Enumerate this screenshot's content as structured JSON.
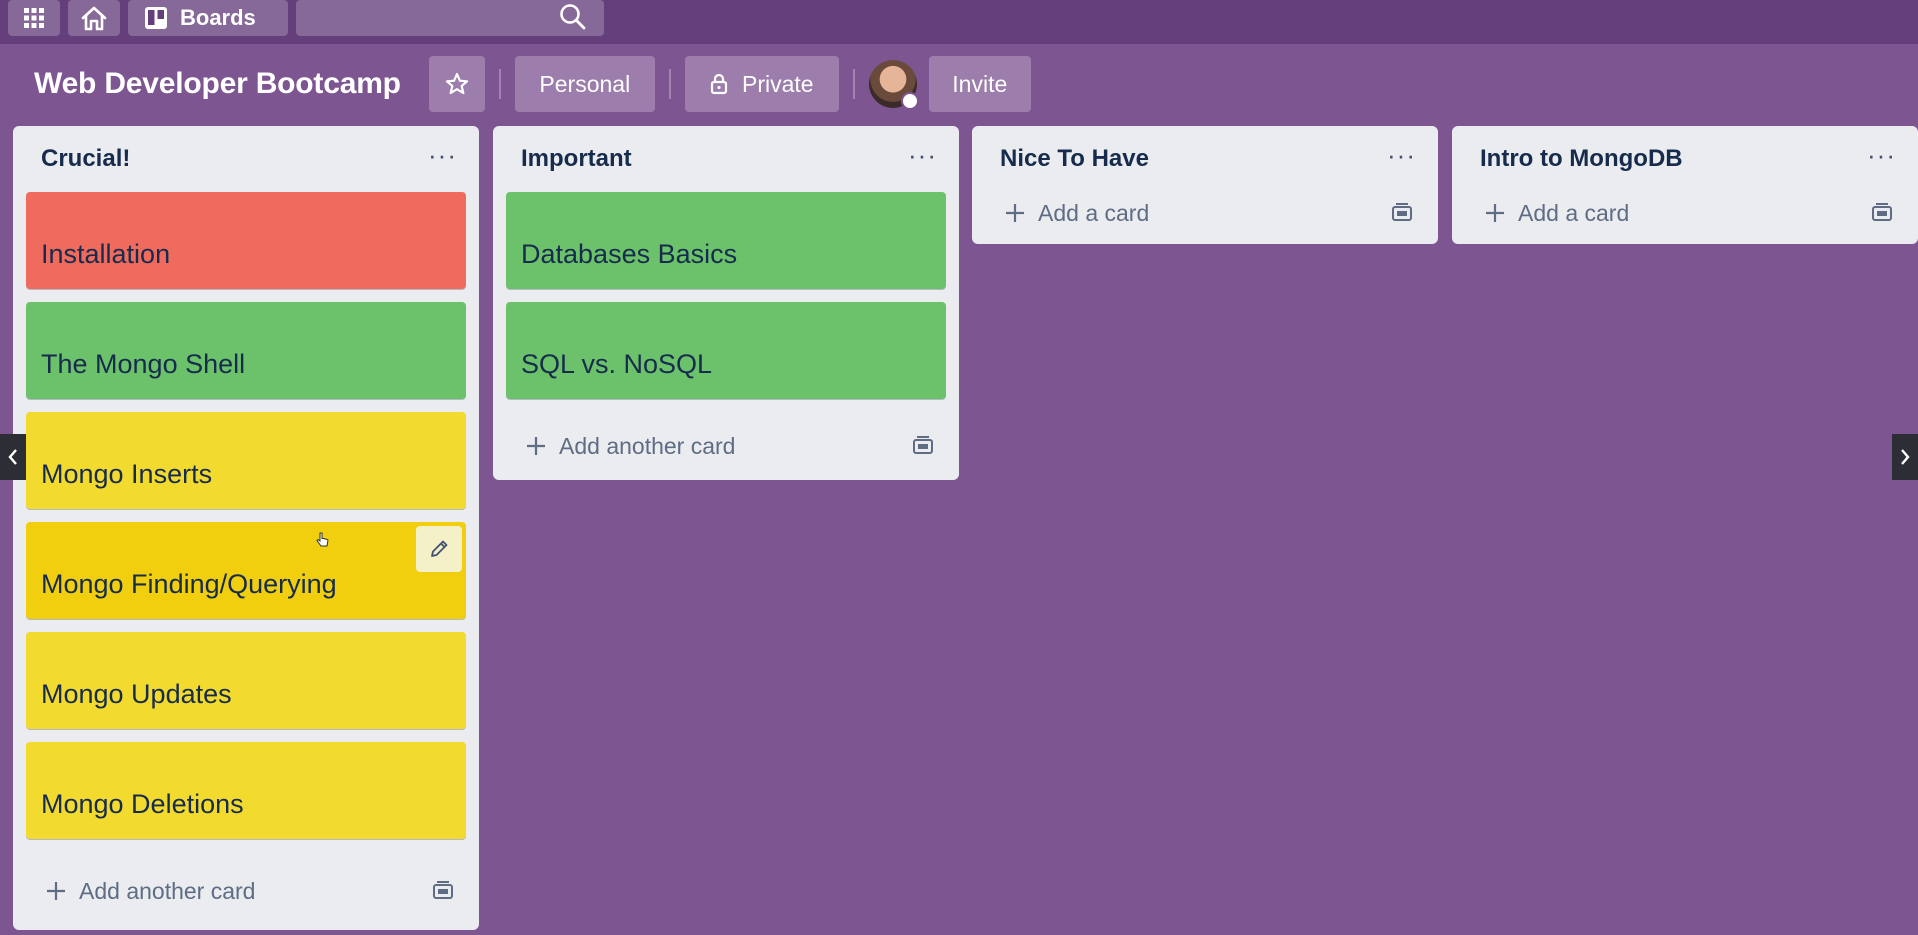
{
  "topbar": {
    "boards_label": "Boards",
    "icons": [
      "apps-grid-icon",
      "home-icon",
      "boards-icon",
      "search-icon"
    ]
  },
  "board": {
    "title": "Web Developer Bootcamp",
    "personal_label": "Personal",
    "private_label": "Private",
    "invite_label": "Invite"
  },
  "lists": [
    {
      "title": "Crucial!",
      "cards": [
        {
          "title": "Installation",
          "color": "#ef6b5e"
        },
        {
          "title": "The Mongo Shell",
          "color": "#6cc26a"
        },
        {
          "title": "Mongo Inserts",
          "color": "#f3da2e"
        },
        {
          "title": "Mongo Finding/Querying",
          "color": "#f1cf0e"
        },
        {
          "title": "Mongo Updates",
          "color": "#f3da2e"
        },
        {
          "title": "Mongo Deletions",
          "color": "#f3da2e"
        }
      ],
      "add_label": "Add another card"
    },
    {
      "title": "Important",
      "cards": [
        {
          "title": "Databases Basics",
          "color": "#6cc26a"
        },
        {
          "title": "SQL vs. NoSQL",
          "color": "#6cc26a"
        }
      ],
      "add_label": "Add another card"
    },
    {
      "title": "Nice To Have",
      "cards": [],
      "add_label": "Add a card"
    },
    {
      "title": "Intro to MongoDB",
      "cards": [],
      "add_label": "Add a card"
    }
  ],
  "colors": {
    "background": "#7d5591",
    "topbar": "#653f7b",
    "list_bg": "#ebecf0",
    "text": "#172b4d"
  }
}
